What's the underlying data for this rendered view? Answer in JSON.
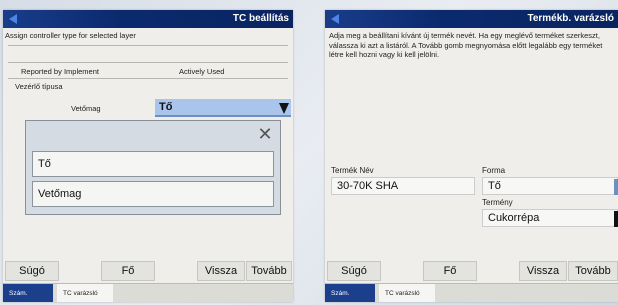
{
  "left": {
    "title": "TC beállítás",
    "assign_text": "Assign controller type for selected layer",
    "columns": [
      "Reported by Implement",
      "Actively Used"
    ],
    "vezerlo_label": "Vezérlő típusa",
    "row_label": "Vetőmag",
    "selected": "Tő",
    "popup_options": [
      "Tő",
      "Vetőmag"
    ],
    "popup_close": "✕",
    "buttons": {
      "help": "Súgó",
      "main": "Fő",
      "back": "Vissza",
      "next": "Tovább"
    },
    "tabs": [
      "Szám.",
      "TC varázsló"
    ]
  },
  "right": {
    "title": "Termékb. varázsló",
    "description": "Adja meg a beállítani kívánt új termék nevét. Ha egy meglévő terméket szerkeszt, válassza ki azt a listáról. A Tovább gomb megnyomása előtt legalább egy terméket létre kell hozni vagy ki kell jelölni.",
    "product_name_label": "Termék Név",
    "product_name_value": "30-70K SHA",
    "forma_label": "Forma",
    "forma_value": "Tő",
    "termeny_label": "Termény",
    "termeny_value": "Cukorrépa",
    "buttons": {
      "help": "Súgó",
      "main": "Fő",
      "back": "Vissza",
      "next": "Tovább"
    },
    "tabs": [
      "Szám.",
      "TC varázsló"
    ]
  }
}
